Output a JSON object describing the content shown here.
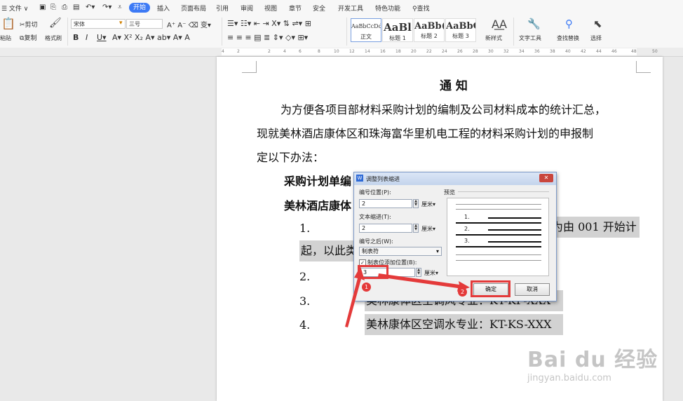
{
  "menubar": {
    "file": "☰ 文件 ∨",
    "tabs": [
      "开始",
      "插入",
      "页面布局",
      "引用",
      "审阅",
      "视图",
      "章节",
      "安全",
      "开发工具",
      "特色功能"
    ],
    "search": "查找"
  },
  "ribbon": {
    "paste": "粘贴",
    "cut": "剪切",
    "copy": "复制",
    "format_painter": "格式刷",
    "font_name": "宋体",
    "font_size": "三号",
    "styles": [
      {
        "preview": "AaBbCcDd",
        "label": "正文"
      },
      {
        "preview": "AaBl",
        "label": "标题 1"
      },
      {
        "preview": "AaBb(",
        "label": "标题 2"
      },
      {
        "preview": "AaBbC",
        "label": "标题 3"
      }
    ],
    "new_style": "新样式",
    "text_tools": "文字工具",
    "find_replace": "查找替换",
    "select": "选择"
  },
  "ruler": {
    "ticks": [
      "4",
      "2",
      "2",
      "4",
      "6",
      "8",
      "10",
      "12",
      "14",
      "16",
      "18",
      "20",
      "22",
      "24",
      "26",
      "28",
      "30",
      "32",
      "34",
      "36",
      "38",
      "40",
      "42",
      "44",
      "46",
      "48",
      "50"
    ]
  },
  "document": {
    "title": "通  知",
    "para1": "为方便各项目部材料采购计划的编制及公司材料成本的统计汇总，",
    "para2": "现就美林酒店康体区和珠海富华里机电工程的材料采购计划的申报制",
    "para3": "定以下办法：",
    "heading1": "采购计划单编",
    "heading2": "美林酒店康体",
    "item1_num": "1.",
    "item1_tail": "为由 001 开始计",
    "item1_cont": "起，以此类",
    "item2_num": "2.",
    "item3_num": "3.",
    "item3_text": "美林康体区空调风专业：KT-KF-XXX",
    "item4_num": "4.",
    "item4_text": "美林康体区空调水专业：KT-KS-XXX"
  },
  "dialog": {
    "title": "调整列表缩进",
    "number_position_label": "编号位置(P):",
    "number_position_value": "2",
    "unit": "厘米▾",
    "text_indent_label": "文本缩进(T):",
    "text_indent_value": "2",
    "after_number_label": "编号之后(W):",
    "after_number_value": "制表符",
    "tab_stop_label": "制表位添加位置(B):",
    "tab_stop_value": "3",
    "tab_stop_checked": true,
    "preview_label": "预览",
    "preview_items": [
      "1.",
      "2.",
      "3."
    ],
    "ok": "确定",
    "cancel": "取消",
    "badge1": "1",
    "badge2": "2"
  },
  "watermark": {
    "brand": "Bai du 经验",
    "url": "jingyan.baidu.com"
  },
  "colors": {
    "accent": "#3d7af5",
    "annotation_red": "#e43a3a",
    "highlight": "#d2d2d2"
  }
}
